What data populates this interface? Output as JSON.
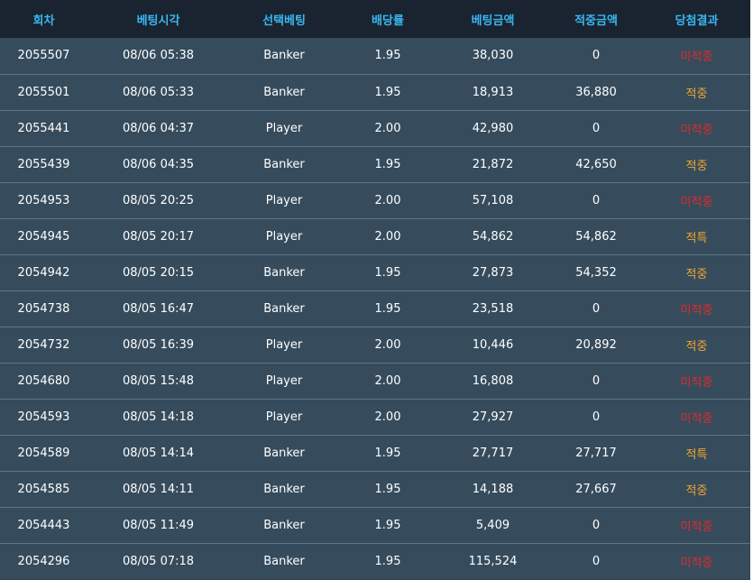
{
  "table": {
    "headers": [
      "회차",
      "베팅시각",
      "선택베팅",
      "배당률",
      "베팅금액",
      "적중금액",
      "당첨결과"
    ],
    "rows": [
      [
        "2055507",
        "08/06 05:38",
        "Banker",
        "1.95",
        "38,030",
        "0",
        "미적중"
      ],
      [
        "2055501",
        "08/06 05:33",
        "Banker",
        "1.95",
        "18,913",
        "36,880",
        "적중"
      ],
      [
        "2055441",
        "08/06 04:37",
        "Player",
        "2.00",
        "42,980",
        "0",
        "미적중"
      ],
      [
        "2055439",
        "08/06 04:35",
        "Banker",
        "1.95",
        "21,872",
        "42,650",
        "적중"
      ],
      [
        "2054953",
        "08/05 20:25",
        "Player",
        "2.00",
        "57,108",
        "0",
        "미적중"
      ],
      [
        "2054945",
        "08/05 20:17",
        "Player",
        "2.00",
        "54,862",
        "54,862",
        "적특"
      ],
      [
        "2054942",
        "08/05 20:15",
        "Banker",
        "1.95",
        "27,873",
        "54,352",
        "적중"
      ],
      [
        "2054738",
        "08/05 16:47",
        "Banker",
        "1.95",
        "23,518",
        "0",
        "미적중"
      ],
      [
        "2054732",
        "08/05 16:39",
        "Player",
        "2.00",
        "10,446",
        "20,892",
        "적중"
      ],
      [
        "2054680",
        "08/05 15:48",
        "Player",
        "2.00",
        "16,808",
        "0",
        "미적중"
      ],
      [
        "2054593",
        "08/05 14:18",
        "Player",
        "2.00",
        "27,927",
        "0",
        "미적중"
      ],
      [
        "2054589",
        "08/05 14:14",
        "Banker",
        "1.95",
        "27,717",
        "27,717",
        "적특"
      ],
      [
        "2054585",
        "08/05 14:11",
        "Banker",
        "1.95",
        "14,188",
        "27,667",
        "적중"
      ],
      [
        "2054443",
        "08/05 11:49",
        "Banker",
        "1.95",
        "5,409",
        "0",
        "미적중"
      ],
      [
        "2054296",
        "08/05 07:18",
        "Banker",
        "1.95",
        "115,524",
        "0",
        "미적중"
      ]
    ]
  },
  "colors": {
    "header_bg": "#1a2330",
    "header_text": "#38b8f2",
    "row_bg": "#364c5d",
    "row_divider": "#5d7787",
    "text": "#ffffff",
    "hit": "#f2a52e",
    "miss": "#e02a2a"
  }
}
